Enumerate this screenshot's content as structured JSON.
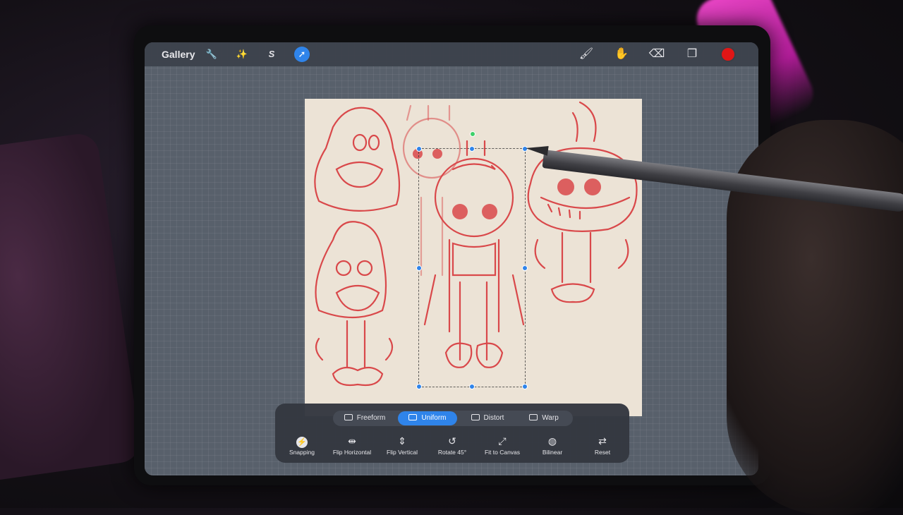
{
  "topbar": {
    "gallery_label": "Gallery",
    "tools": [
      {
        "name": "wrench-icon",
        "glyph": "🔧"
      },
      {
        "name": "magic-wand-icon",
        "glyph": "✨"
      },
      {
        "name": "selection-s-icon",
        "glyph": "S"
      },
      {
        "name": "transform-arrow-icon",
        "glyph": "➚"
      }
    ],
    "right_tools": [
      {
        "name": "brush-icon",
        "glyph": "🖌"
      },
      {
        "name": "smudge-icon",
        "glyph": "✋"
      },
      {
        "name": "eraser-icon",
        "glyph": "⌫"
      },
      {
        "name": "layers-icon",
        "glyph": "❐"
      }
    ],
    "current_color": "#e01616"
  },
  "transform_modes": [
    {
      "label": "Freeform"
    },
    {
      "label": "Uniform"
    },
    {
      "label": "Distort"
    },
    {
      "label": "Warp"
    }
  ],
  "active_mode": "Uniform",
  "transform_actions": [
    {
      "label": "Snapping",
      "glyph": "⚡"
    },
    {
      "label": "Flip Horizontal",
      "glyph": "⇹"
    },
    {
      "label": "Flip Vertical",
      "glyph": "⇕"
    },
    {
      "label": "Rotate 45°",
      "glyph": "↺"
    },
    {
      "label": "Fit to Canvas",
      "glyph": "⤢"
    },
    {
      "label": "Bilinear",
      "glyph": "◍"
    },
    {
      "label": "Reset",
      "glyph": "⇄"
    }
  ],
  "accent_color": "#2f84ea",
  "sketch_color": "#d9484a"
}
